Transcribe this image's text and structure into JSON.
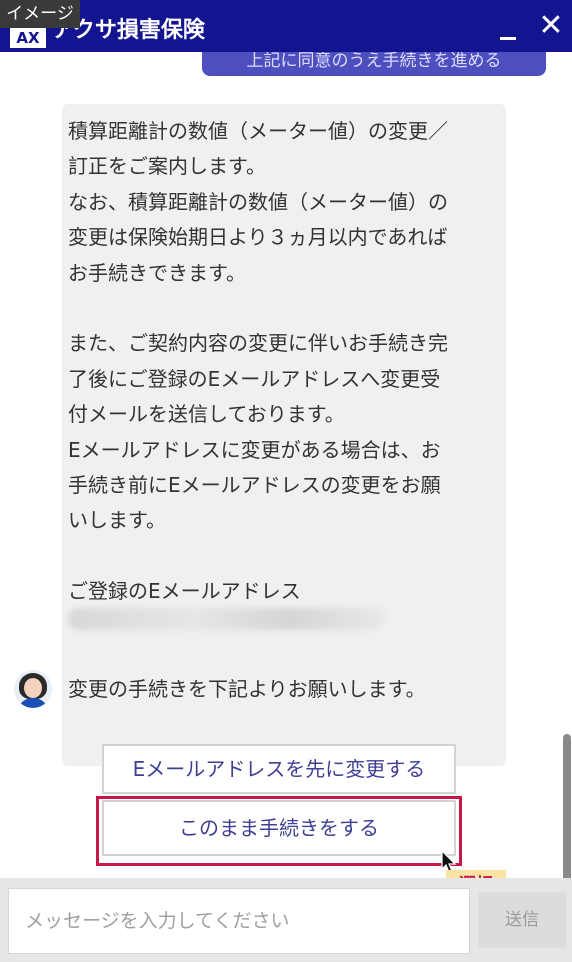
{
  "header": {
    "badge": "イメージ",
    "logo": "AX",
    "brand": "アクサ損害保険",
    "minimize_icon": "minimize-icon",
    "close_icon": "close-icon",
    "close_glyph": "✕",
    "background": "#13148f"
  },
  "chat": {
    "user_message": "上記に同意のうえ手続きを進める",
    "bot_message": "積算距離計の数値（メーター値）の変更／\n訂正をご案内します。\nなお、積算距離計の数値（メーター値）の\n変更は保険始期日より３ヵ月以内であれば\nお手続きできます。\n\nまた、ご契約内容の変更に伴いお手続き完\n了後にご登録のEメールアドレスへ変更受\n付メールを送信しております。\nEメールアドレスに変更がある場合は、お\n手続き前にEメールアドレスの変更をお願\nいします。\n\nご登録のEメールアドレス",
    "bot_message_last": "変更の手続きを下記よりお願いします。"
  },
  "choices": {
    "option1": "Eメールアドレスを先に変更する",
    "option2": "このまま手続きをする"
  },
  "annotation": {
    "select_label": "選択",
    "highlight_color": "#c8164a"
  },
  "input": {
    "placeholder": "メッセージを入力してください",
    "send_label": "送信"
  }
}
